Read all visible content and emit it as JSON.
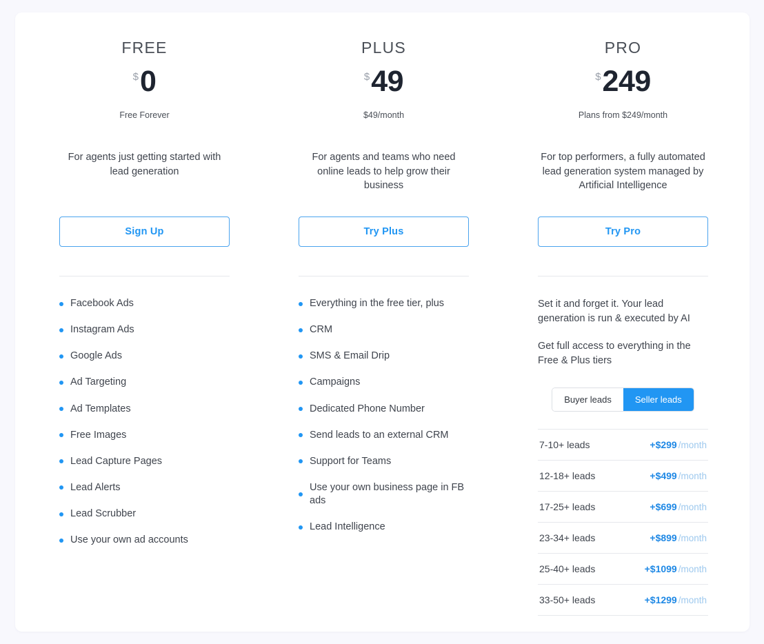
{
  "plans": [
    {
      "name": "FREE",
      "currency": "$",
      "amount": "0",
      "price_note": "Free Forever",
      "description": "For agents just getting started with lead generation",
      "cta_label": "Sign Up",
      "features": [
        "Facebook Ads",
        "Instagram Ads",
        "Google Ads",
        "Ad Targeting",
        "Ad Templates",
        "Free Images",
        "Lead Capture Pages",
        "Lead Alerts",
        "Lead Scrubber",
        "Use your own ad accounts"
      ]
    },
    {
      "name": "PLUS",
      "currency": "$",
      "amount": "49",
      "price_note": "$49/month",
      "description": "For agents and teams who need online leads to help grow their business",
      "cta_label": "Try Plus",
      "features": [
        "Everything in the free tier, plus",
        "CRM",
        "SMS & Email Drip",
        "Campaigns",
        "Dedicated Phone Number",
        "Send leads to an external CRM",
        "Support for Teams",
        "Use your own business page in FB ads",
        "Lead Intelligence"
      ]
    },
    {
      "name": "PRO",
      "currency": "$",
      "amount": "249",
      "price_note": "Plans from $249/month",
      "description": "For top performers, a fully automated lead generation system managed by Artificial Intelligence",
      "cta_label": "Try Pro",
      "blurbs": [
        "Set it and forget it. Your lead generation is run & executed by AI",
        "Get full access to everything in the Free & Plus tiers"
      ],
      "lead_toggle": {
        "options": [
          {
            "label": "Buyer leads",
            "active": false
          },
          {
            "label": "Seller leads",
            "active": true
          }
        ]
      },
      "lead_tiers": [
        {
          "leads": "7-10+ leads",
          "price": "+$299",
          "period": "/month"
        },
        {
          "leads": "12-18+ leads",
          "price": "+$499",
          "period": "/month"
        },
        {
          "leads": "17-25+ leads",
          "price": "+$699",
          "period": "/month"
        },
        {
          "leads": "23-34+ leads",
          "price": "+$899",
          "period": "/month"
        },
        {
          "leads": "25-40+ leads",
          "price": "+$1099",
          "period": "/month"
        },
        {
          "leads": "33-50+ leads",
          "price": "+$1299",
          "period": "/month"
        }
      ]
    }
  ],
  "colors": {
    "accent": "#2196f3",
    "accent_dark": "#1e88e5",
    "period_muted": "#9ec9ee",
    "text": "#3f444d",
    "heading": "#4a4f57",
    "page_bg": "#f8f8fd",
    "card_bg": "#ffffff",
    "divider": "#e6e8ec"
  }
}
